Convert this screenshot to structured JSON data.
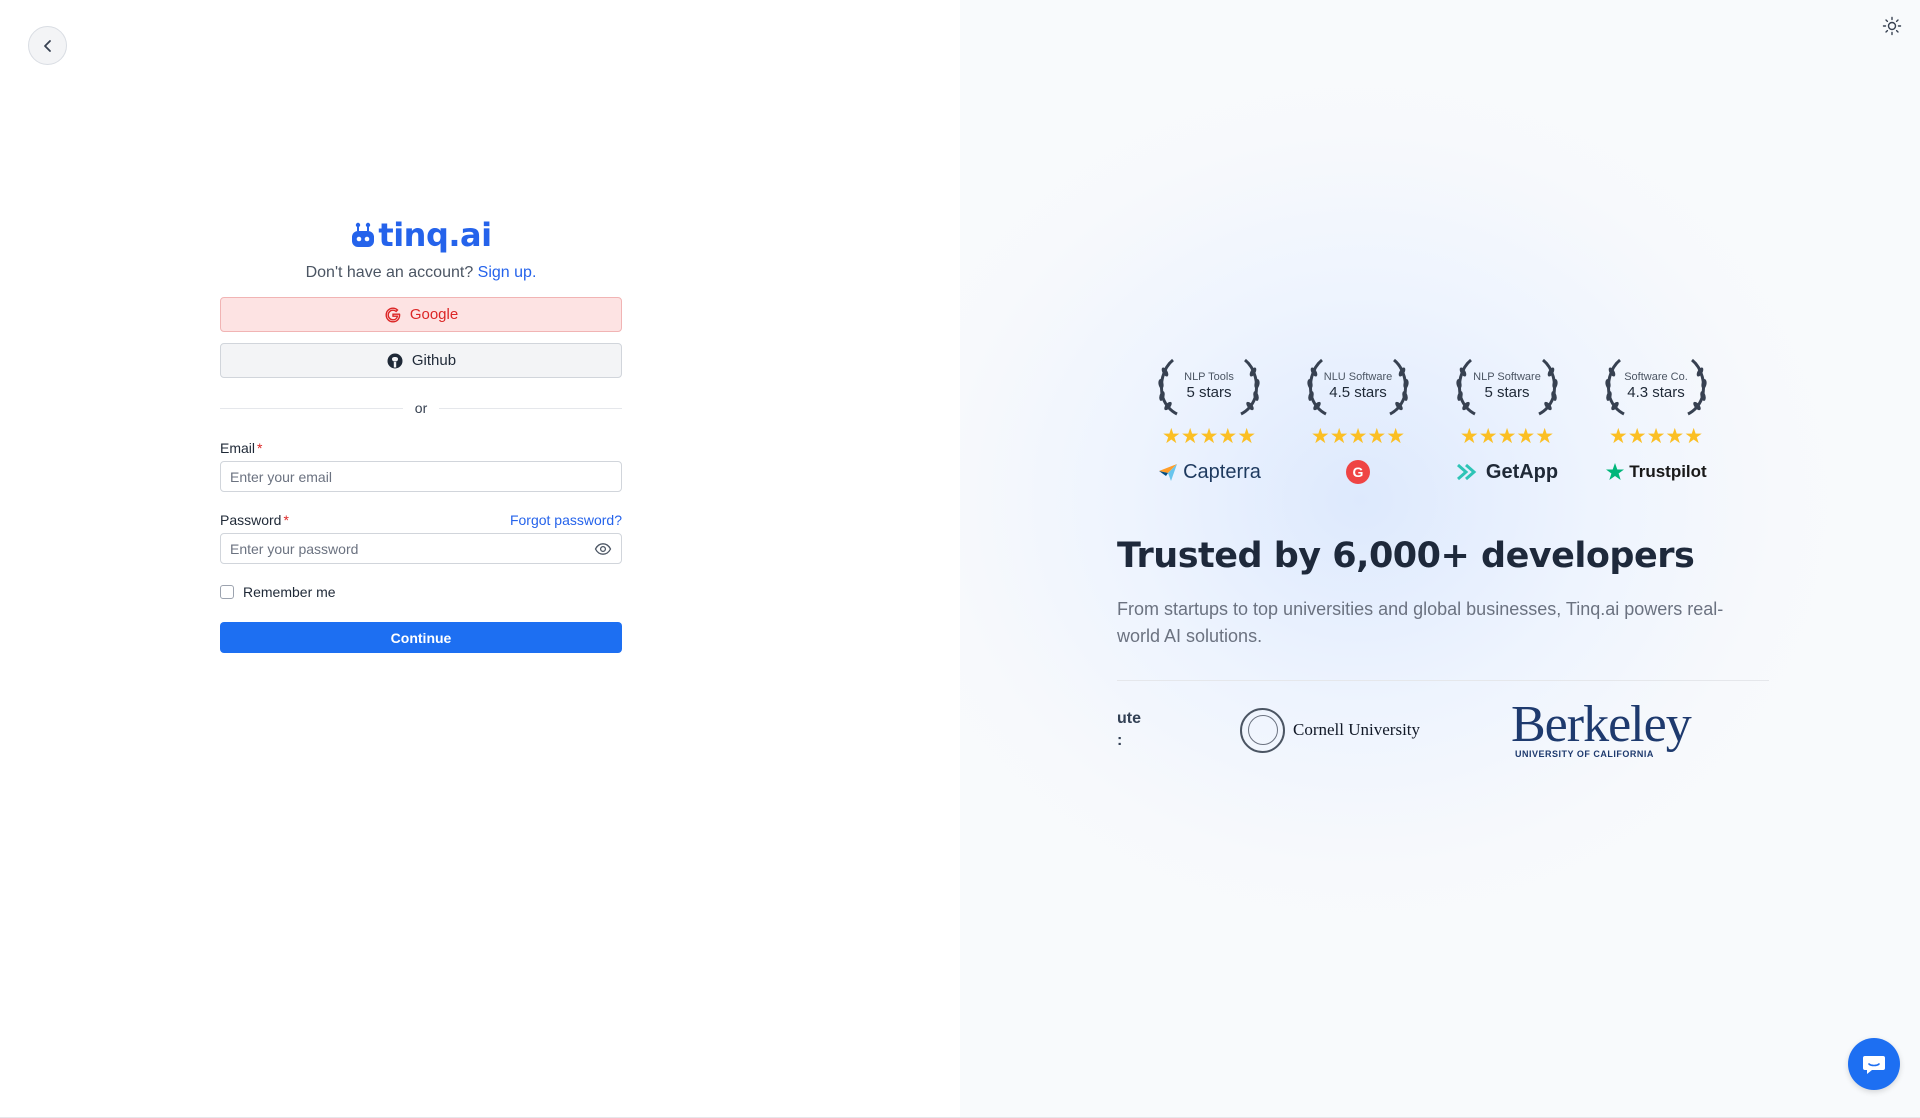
{
  "brand": {
    "name": "tinq.ai"
  },
  "signup": {
    "prompt": "Don't have an account?",
    "link": "Sign up."
  },
  "oauth": {
    "google_label": "Google",
    "github_label": "Github"
  },
  "divider": {
    "text": "or"
  },
  "email": {
    "label": "Email",
    "required": "*",
    "placeholder": "Enter your email"
  },
  "password": {
    "label": "Password",
    "required": "*",
    "forgot": "Forgot password?",
    "placeholder": "Enter your password"
  },
  "remember": {
    "label": "Remember me"
  },
  "continue": {
    "label": "Continue"
  },
  "awards": [
    {
      "category": "NLP Tools",
      "stars": "5 stars",
      "rating_glyphs": "★★★★★",
      "platform": "Capterra"
    },
    {
      "category": "NLU Software",
      "stars": "4.5 stars",
      "rating_glyphs": "★★★★★",
      "platform": "G2"
    },
    {
      "category": "NLP Software",
      "stars": "5 stars",
      "rating_glyphs": "★★★★★",
      "platform": "GetApp"
    },
    {
      "category": "Software Co.",
      "stars": "4.3 stars",
      "rating_glyphs": "★★★★★",
      "platform": "Trustpilot"
    }
  ],
  "hero": {
    "headline": "Trusted by 6,000+ developers",
    "subtext": "From startups to top universities and global businesses, Tinq.ai powers real-world AI solutions."
  },
  "logos": {
    "fragment": "ute",
    "fragment_line2": ":",
    "cornell": "Cornell University",
    "berkeley": "Berkeley",
    "berkeley_sub": "UNIVERSITY OF CALIFORNIA"
  },
  "colors": {
    "accent": "#1d6ff2",
    "link": "#2563eb",
    "google_bg": "#fde3e3",
    "star": "#fbbf24"
  }
}
